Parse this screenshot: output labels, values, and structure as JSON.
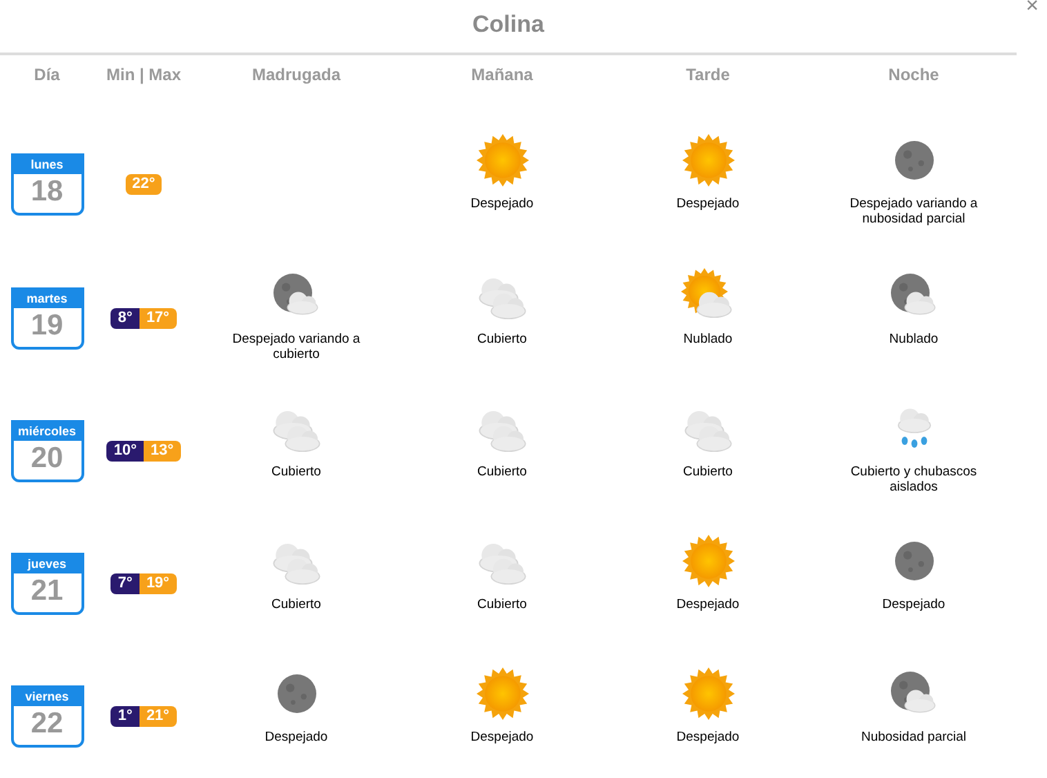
{
  "title": "Colina",
  "close": "×",
  "columns": [
    "Día",
    "Min | Max",
    "Madrugada",
    "Mañana",
    "Tarde",
    "Noche"
  ],
  "days": [
    {
      "weekday": "lunes",
      "date": "18",
      "max": "22°",
      "manana": {
        "kind": "sun",
        "condition": "Despejado"
      },
      "tarde": {
        "kind": "sun",
        "condition": "Despejado"
      },
      "noche": {
        "kind": "moon",
        "condition": "Despejado variando a nubosidad parcial"
      }
    },
    {
      "weekday": "martes",
      "date": "19",
      "min": "8°",
      "max": "17°",
      "madrugada": {
        "kind": "moon_cloud",
        "condition": "Despejado variando a cubierto"
      },
      "manana": {
        "kind": "clouds",
        "condition": "Cubierto"
      },
      "tarde": {
        "kind": "sun_cloud",
        "condition": "Nublado"
      },
      "noche": {
        "kind": "moon_cloud",
        "condition": "Nublado"
      }
    },
    {
      "weekday": "miércoles",
      "date": "20",
      "min": "10°",
      "max": "13°",
      "madrugada": {
        "kind": "clouds",
        "condition": "Cubierto"
      },
      "manana": {
        "kind": "clouds",
        "condition": "Cubierto"
      },
      "tarde": {
        "kind": "clouds",
        "condition": "Cubierto"
      },
      "noche": {
        "kind": "rain",
        "condition": "Cubierto y chubascos aislados"
      }
    },
    {
      "weekday": "jueves",
      "date": "21",
      "min": "7°",
      "max": "19°",
      "madrugada": {
        "kind": "clouds",
        "condition": "Cubierto"
      },
      "manana": {
        "kind": "clouds",
        "condition": "Cubierto"
      },
      "tarde": {
        "kind": "sun",
        "condition": "Despejado"
      },
      "noche": {
        "kind": "moon",
        "condition": "Despejado"
      }
    },
    {
      "weekday": "viernes",
      "date": "22",
      "min": "1°",
      "max": "21°",
      "madrugada": {
        "kind": "moon",
        "condition": "Despejado"
      },
      "manana": {
        "kind": "sun",
        "condition": "Despejado"
      },
      "tarde": {
        "kind": "sun",
        "condition": "Despejado"
      },
      "noche": {
        "kind": "moon_cloud",
        "condition": "Nubosidad parcial"
      }
    }
  ]
}
